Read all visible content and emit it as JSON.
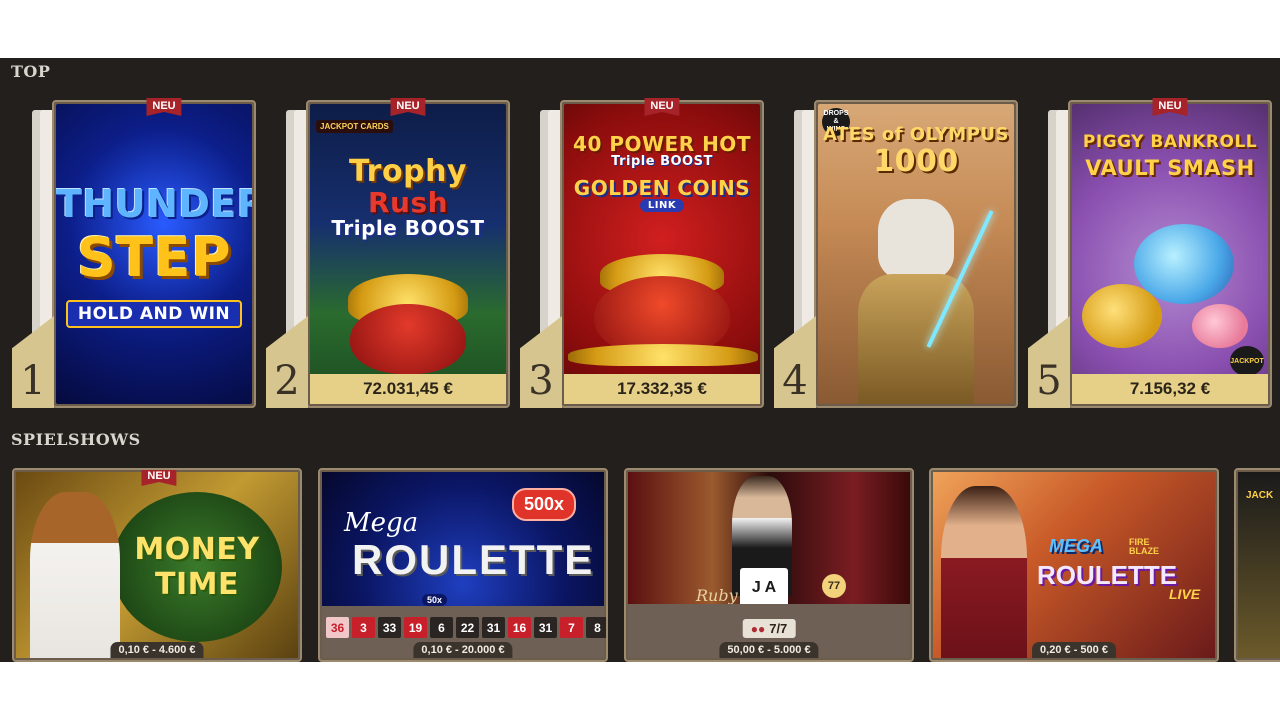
{
  "sections": {
    "top": {
      "title": "TOP"
    },
    "shows": {
      "title": "SPIELSHOWS"
    }
  },
  "top_games": [
    {
      "rank": "1",
      "title_line1": "THUNDER",
      "title_line2": "STEP",
      "subtitle": "HOLD AND WIN",
      "badge": "NEU",
      "jackpot": ""
    },
    {
      "rank": "2",
      "logo_text": "JACKPOT CARDS",
      "title_line1": "Trophy",
      "title_line2": "Rush",
      "subtitle": "Triple BOOST",
      "badge": "NEU",
      "jackpot": "72.031,45 €"
    },
    {
      "rank": "3",
      "title_line1": "40 POWER HOT",
      "title_line2": "Triple BOOST",
      "subtitle": "GOLDEN COINS",
      "subtitle2": "LINK",
      "badge": "NEU",
      "jackpot": "17.332,35 €"
    },
    {
      "rank": "4",
      "logo_text": "DROPS & WINS",
      "title_line1": "ATES of OLYMPUS",
      "title_line2": "1000",
      "badge": "",
      "jackpot": ""
    },
    {
      "rank": "5",
      "title_line1": "PIGGY BANKROLL",
      "title_line2": "VAULT SMASH",
      "logo_text": "JACKPOT",
      "badge": "NEU",
      "jackpot": "7.156,32 €"
    }
  ],
  "game_shows": [
    {
      "title": "MONEY TIME",
      "badge": "NEU",
      "limits": "0,10 € - 4.600 €"
    },
    {
      "title_line1": "Mega",
      "title_line2": "ROULETTE",
      "multiplier": "500x",
      "sub_badge": "50x",
      "limits": "0,10 € - 20.000 €",
      "results": [
        {
          "n": "36",
          "c": "hl"
        },
        {
          "n": "3",
          "c": "red"
        },
        {
          "n": "33",
          "c": "black"
        },
        {
          "n": "19",
          "c": "red"
        },
        {
          "n": "6",
          "c": "black"
        },
        {
          "n": "22",
          "c": "black"
        },
        {
          "n": "31",
          "c": "black"
        },
        {
          "n": "16",
          "c": "red"
        },
        {
          "n": "31",
          "c": "black"
        },
        {
          "n": "7",
          "c": "red"
        },
        {
          "n": "8",
          "c": "black"
        }
      ]
    },
    {
      "table_name": "Ruby",
      "cards": "J A",
      "count": "77",
      "seats": "7/7",
      "limits": "50,00 € - 5.000 €"
    },
    {
      "title_line1": "MEGA",
      "title_line2": "ROULETTE",
      "fire": "FIRE BLAZE",
      "live": "LIVE",
      "limits": "0,20 € - 500 €"
    },
    {
      "logo_text": "JACK"
    }
  ],
  "colors": {
    "background": "#221f1d",
    "gold": "#e6cf86",
    "badge_red": "#a6232a"
  }
}
